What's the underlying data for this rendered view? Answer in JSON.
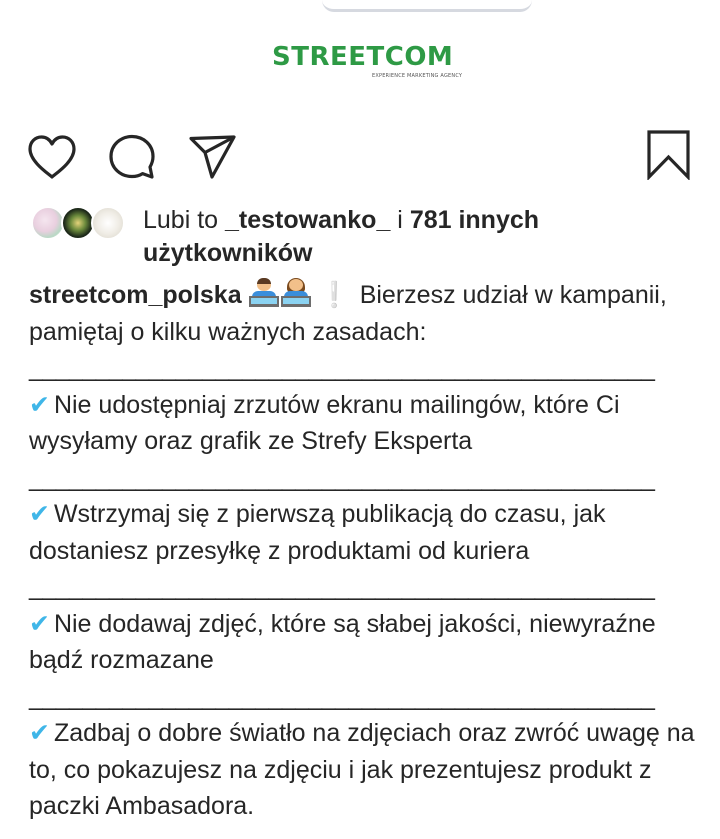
{
  "brand": {
    "name": "STREETCOM",
    "tagline": "EXPERIENCE MARKETING AGENCY"
  },
  "actions": {
    "like_icon": "heart-outline-icon",
    "comment_icon": "comment-bubble-icon",
    "share_icon": "paper-plane-icon",
    "save_icon": "bookmark-outline-icon"
  },
  "likes": {
    "prefix": "Lubi to ",
    "first_user": "_testowanko_",
    "middle": " i ",
    "others": "781 innych użytkowników"
  },
  "caption": {
    "username": "streetcom_polska",
    "emojis": [
      "man-technologist-emoji",
      "woman-technologist-emoji"
    ],
    "exclamation": "❕",
    "intro": "Bierzesz udział w kampanii, pamiętaj o kilku ważnych zasadach:",
    "divider": "_______________________________________________",
    "check_symbol": "✔",
    "rules": [
      "Nie udostępniaj zrzutów ekranu mailingów, które Ci wysyłamy oraz grafik ze Strefy Eksperta",
      "Wstrzymaj się z pierwszą publikacją do czasu, jak dostaniesz przesyłkę z produktami od kuriera",
      "Nie dodawaj zdjęć, które są słabej jakości, niewyraźne bądź rozmazane",
      "Zadbaj o dobre światło na zdjęciach oraz zwróć uwagę na to, co pokazujesz na zdjęciu i jak prezentujesz produkt z paczki Ambasadora."
    ]
  },
  "colors": {
    "brand_green": "#2e9a45",
    "check_blue": "#3fb6e8",
    "text": "#262626"
  }
}
